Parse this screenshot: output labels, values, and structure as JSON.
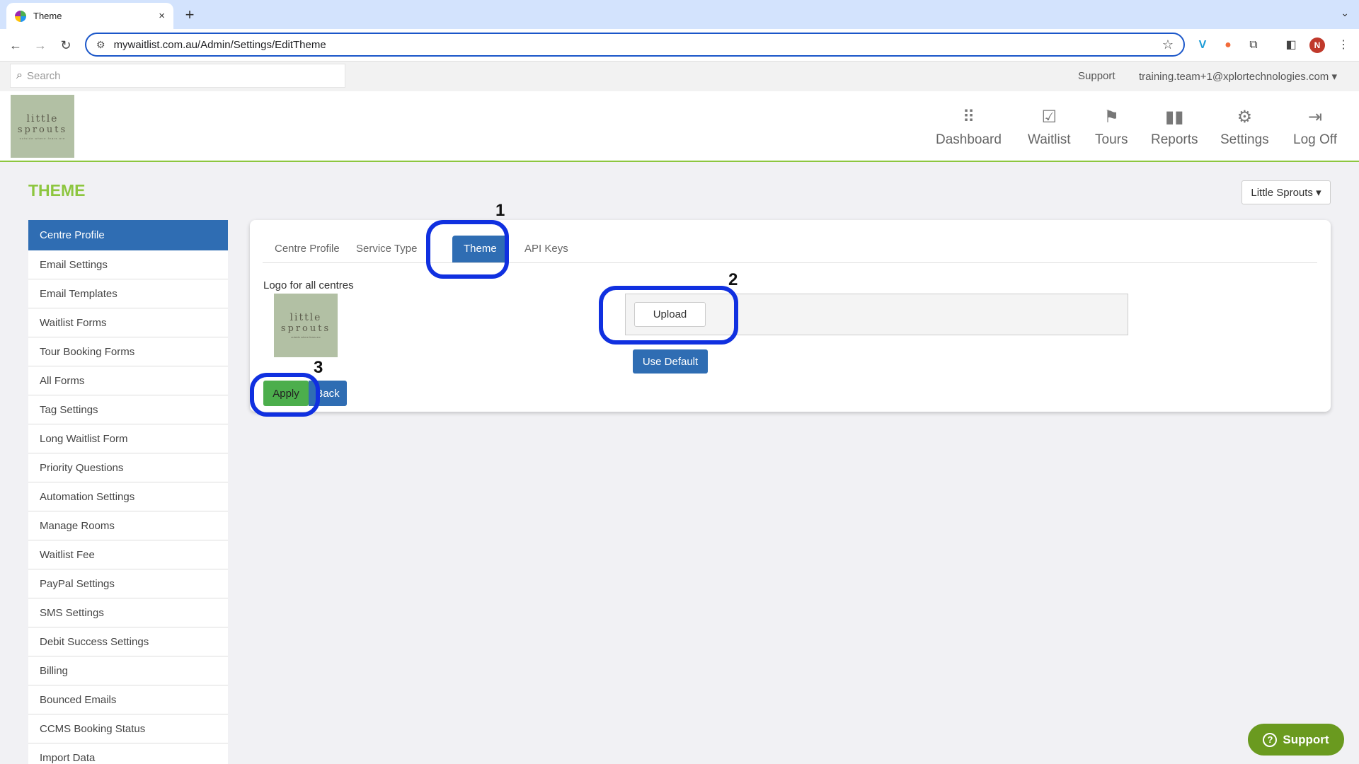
{
  "browser": {
    "tab_title": "Theme",
    "tab_close": "×",
    "new_tab": "+",
    "url": "mywaitlist.com.au/Admin/Settings/EditTheme",
    "profile_initial": "N"
  },
  "appbar": {
    "search_placeholder": "Search",
    "support": "Support",
    "user": "training.team+1@xplortechnologies.com ▾"
  },
  "logo": {
    "line1": "little",
    "line2": "sprouts",
    "tagline": "outside where fears are"
  },
  "nav": [
    {
      "label": "Dashboard",
      "icon": "dashboard-icon"
    },
    {
      "label": "Waitlist",
      "icon": "waitlist-icon"
    },
    {
      "label": "Tours",
      "icon": "tours-icon"
    },
    {
      "label": "Reports",
      "icon": "reports-icon"
    },
    {
      "label": "Settings",
      "icon": "gear-icon"
    },
    {
      "label": "Log Off",
      "icon": "logoff-icon"
    }
  ],
  "page": {
    "title": "THEME",
    "centre_select": "Little Sprouts ▾"
  },
  "sidebar": {
    "items": [
      {
        "label": "Centre Profile",
        "active": true
      },
      {
        "label": "Email Settings"
      },
      {
        "label": "Email Templates"
      },
      {
        "label": "Waitlist Forms"
      },
      {
        "label": "Tour Booking Forms"
      },
      {
        "label": "All Forms"
      },
      {
        "label": "Tag Settings"
      },
      {
        "label": "Long Waitlist Form"
      },
      {
        "label": "Priority Questions"
      },
      {
        "label": "Automation Settings"
      },
      {
        "label": "Manage Rooms"
      },
      {
        "label": "Waitlist Fee"
      },
      {
        "label": "PayPal Settings"
      },
      {
        "label": "SMS Settings"
      },
      {
        "label": "Debit Success Settings"
      },
      {
        "label": "Billing"
      },
      {
        "label": "Bounced Emails"
      },
      {
        "label": "CCMS Booking Status"
      },
      {
        "label": "Import Data"
      }
    ]
  },
  "panel": {
    "tabs": [
      "Centre Profile",
      "Service Type",
      "Theme",
      "API Keys"
    ],
    "active_tab": "Theme",
    "logo_label": "Logo for all centres",
    "upload": "Upload",
    "use_default": "Use Default",
    "apply": "Apply",
    "back": "Back"
  },
  "annotations": [
    "1",
    "2",
    "3"
  ],
  "support_fab": "Support",
  "colors": {
    "accent_green": "#8dc63f",
    "primary_blue": "#2f6db3",
    "annotation_blue": "#1030e0"
  }
}
